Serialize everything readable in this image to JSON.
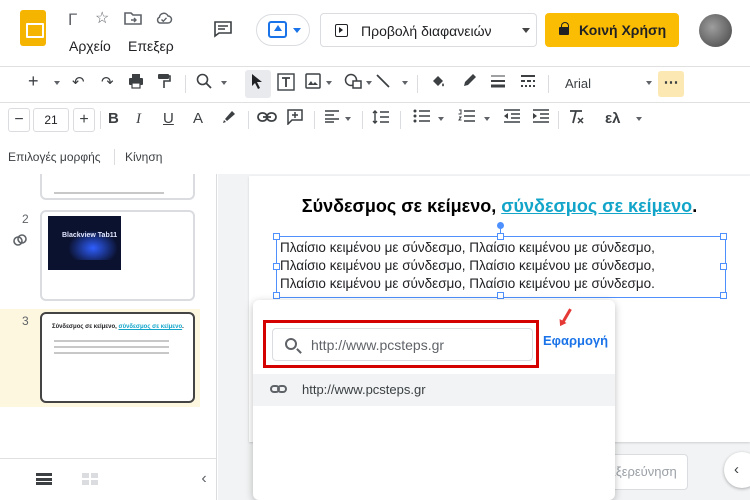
{
  "header": {
    "doc_title_glyph": "Γ",
    "menu": [
      "Αρχείο",
      "Επεξερ"
    ],
    "slideshow_label": "Προβολή διαφανειών",
    "share_label": "Κοινή Χρήση",
    "accent_color": "#fbbc04"
  },
  "toolbar": {
    "font_name": "Arial",
    "font_size": "21",
    "greek_tool": "ελ"
  },
  "context_toolbar": {
    "format_options": "Επιλογές μορφής",
    "motion": "Κίνηση"
  },
  "filmstrip": {
    "slides": [
      {
        "number": "2",
        "image_text": "Blackview Tab11"
      },
      {
        "number": "3",
        "title_plain": "Σύνδεσμος σε κείμενο, ",
        "title_link": "σύνδεσμος σε κείμενο",
        "title_end": "."
      }
    ]
  },
  "slide": {
    "title_plain": "Σύνδεσμος σε κείμενο, ",
    "title_link": "σύνδεσμος σε κείμενο",
    "title_end": ".",
    "textbox_lines": [
      "Πλαίσιο κειμένου με σύνδεσμο, Πλαίσιο κειμένου με σύνδεσμο,",
      "Πλαίσιο κειμένου με σύνδεσμο, Πλαίσιο κειμένου με σύνδεσμο,",
      "Πλαίσιο κειμένου με σύνδεσμο, Πλαίσιο κειμένου με σύνδεσμο."
    ],
    "link_color": "#12a5c9"
  },
  "explore_label": "Εξερεύνηση",
  "link_popup": {
    "url_value": "http://www.pcsteps.gr",
    "apply_label": "Εφαρμογή",
    "suggestion": "http://www.pcsteps.gr",
    "highlight_color": "#d50000"
  }
}
